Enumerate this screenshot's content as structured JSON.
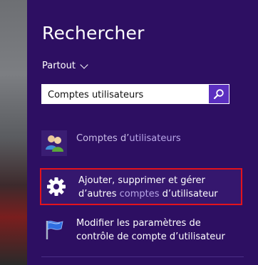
{
  "search_pane": {
    "title": "Rechercher",
    "scope_label": "Partout",
    "search": {
      "value": "Comptes utilisateurs",
      "placeholder": ""
    },
    "search_button_icon": "magnifier-icon"
  },
  "results": [
    {
      "icon": "users-icon",
      "text_line1_a": "Comptes d’",
      "text_line1_b": "utilisateurs",
      "highlighted": false
    },
    {
      "icon": "gear-icon",
      "line1": "Ajouter, supprimer et gérer",
      "line2_a": "d’autres ",
      "line2_hl": "comptes",
      "line2_b": " d’utilisateur",
      "highlighted": true,
      "highlight_color": "#e3131c"
    },
    {
      "icon": "flag-icon",
      "line1": "Modifier les paramètres de",
      "line2": "contrôle de compte d’utilisateur",
      "highlighted": false
    }
  ],
  "colors": {
    "pane_background": "#2d0f62",
    "search_button": "#5b2fc0",
    "accent_text": "#b8a6e8",
    "selection_border": "#e3131c"
  }
}
